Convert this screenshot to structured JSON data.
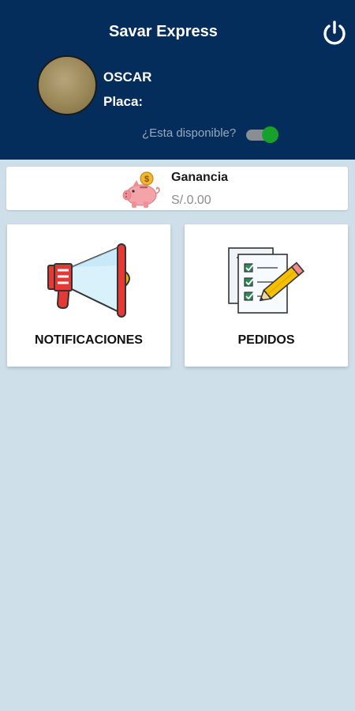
{
  "header": {
    "title": "Savar Express",
    "power_icon": "power-icon",
    "background_color": "#052d5b"
  },
  "profile": {
    "name": "OSCAR",
    "plate_label": "Placa:",
    "availability_label": "¿Esta disponible?",
    "available": true
  },
  "earnings": {
    "title": "Ganancia",
    "value": "S/.0.00",
    "icon": "piggy-bank-icon"
  },
  "tiles": {
    "notifications": {
      "label": "NOTIFICACIONES",
      "icon": "megaphone-icon"
    },
    "orders": {
      "label": "PEDIDOS",
      "icon": "checklist-icon"
    }
  },
  "colors": {
    "body_background": "#cfdfea",
    "toggle_on": "#17a12c"
  }
}
